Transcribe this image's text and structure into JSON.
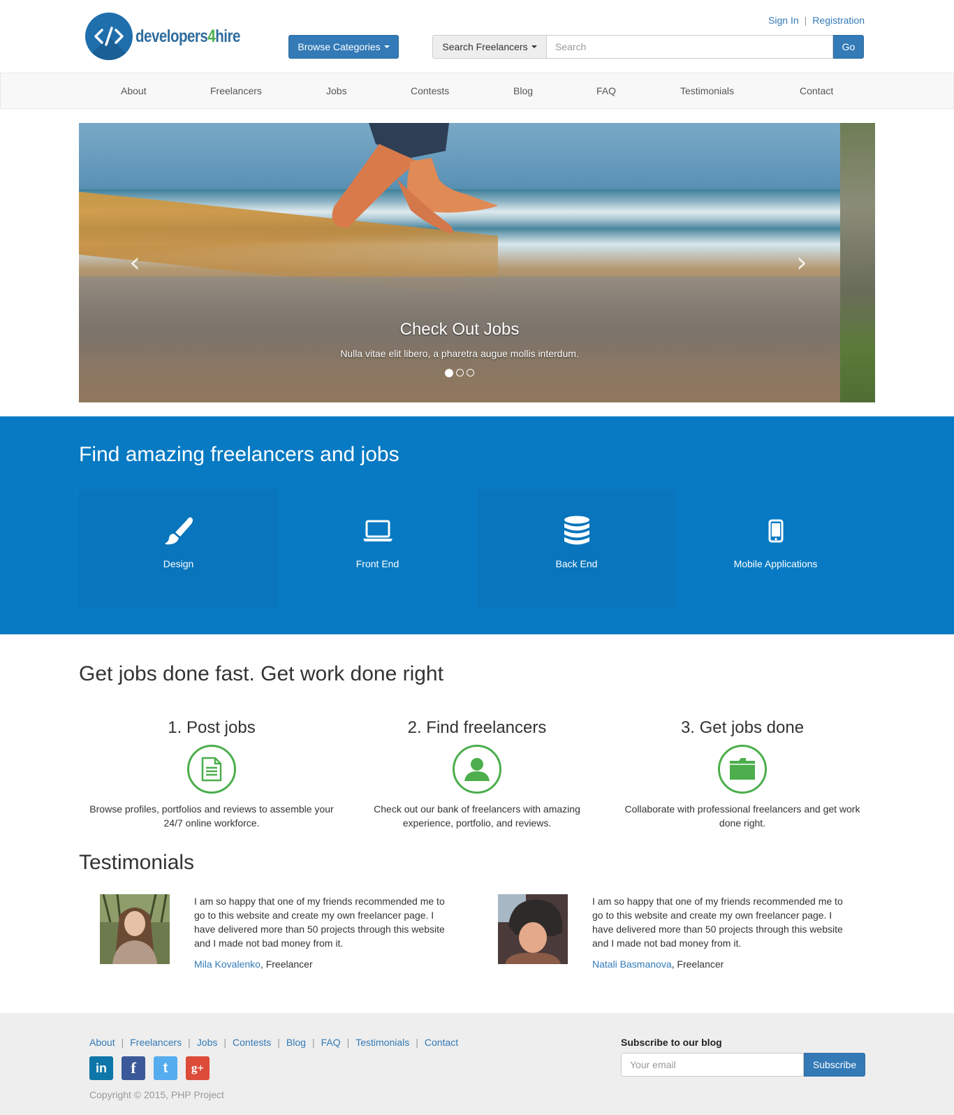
{
  "brand": {
    "name_part1": "developers",
    "name_part2": "4",
    "name_part3": "hire"
  },
  "auth": {
    "sign_in": "Sign In",
    "separator": "|",
    "registration": "Registration"
  },
  "header": {
    "browse_label": "Browse Categories",
    "search_type_label": "Search Freelancers",
    "search_placeholder": "Search",
    "search_go": "Go"
  },
  "nav": {
    "items": [
      {
        "label": "About"
      },
      {
        "label": "Freelancers"
      },
      {
        "label": "Jobs"
      },
      {
        "label": "Contests"
      },
      {
        "label": "Blog"
      },
      {
        "label": "FAQ"
      },
      {
        "label": "Testimonials"
      },
      {
        "label": "Contact"
      }
    ]
  },
  "carousel": {
    "title": "Check Out Jobs",
    "text": "Nulla vitae elit libero, a pharetra augue mollis interdum.",
    "prev": "‹",
    "next": "›",
    "slides_count": 3,
    "active_index": 0
  },
  "categories": {
    "title": "Find amazing freelancers and jobs",
    "items": [
      {
        "label": "Design",
        "icon": "brush-icon"
      },
      {
        "label": "Front End",
        "icon": "laptop-icon"
      },
      {
        "label": "Back End",
        "icon": "database-icon"
      },
      {
        "label": "Mobile Applications",
        "icon": "phone-icon"
      }
    ],
    "bg_color": "#077ac3"
  },
  "steps": {
    "title": "Get jobs done fast. Get work done right",
    "items": [
      {
        "title": "1. Post jobs",
        "icon": "document-icon",
        "text": "Browse profiles, portfolios and reviews to assemble your 24/7 online workforce."
      },
      {
        "title": "2. Find freelancers",
        "icon": "user-icon",
        "text": "Check out our bank of freelancers with amazing experience, portfolio, and reviews."
      },
      {
        "title": "3. Get jobs done",
        "icon": "folder-icon",
        "text": "Collaborate with professional freelancers and get work done right."
      }
    ],
    "accent_color": "#4cae4c"
  },
  "testimonials": {
    "title": "Testimonials",
    "items": [
      {
        "text": "I am so happy that one of my friends recommended me to go to this website and create my own freelancer page. I have delivered more than 50 projects through this website and I made not bad money from it.",
        "name": "Mila Kovalenko",
        "role": ", Freelancer"
      },
      {
        "text": "I am so happy that one of my friends recommended me to go to this website and create my own freelancer page. I have delivered more than 50 projects through this website and I made not bad money from it.",
        "name": "Natali Basmanova",
        "role": ", Freelancer"
      }
    ]
  },
  "footer": {
    "links": [
      {
        "label": "About"
      },
      {
        "label": "Freelancers"
      },
      {
        "label": "Jobs"
      },
      {
        "label": "Contests"
      },
      {
        "label": "Blog"
      },
      {
        "label": "FAQ"
      },
      {
        "label": "Testimonials"
      },
      {
        "label": "Contact"
      }
    ],
    "social": [
      {
        "name": "linkedin-icon",
        "glyph": "in",
        "color": "#0e76a8"
      },
      {
        "name": "facebook-icon",
        "glyph": "f",
        "color": "#3b5998"
      },
      {
        "name": "twitter-icon",
        "glyph": "t",
        "color": "#55acee"
      },
      {
        "name": "google-plus-icon",
        "glyph": "g+",
        "color": "#dd4b39"
      }
    ],
    "copyright": "Copyright © 2015, PHP Project",
    "subscribe_title": "Subscribe to our blog",
    "email_placeholder": "Your email",
    "subscribe_button": "Subscribe"
  }
}
